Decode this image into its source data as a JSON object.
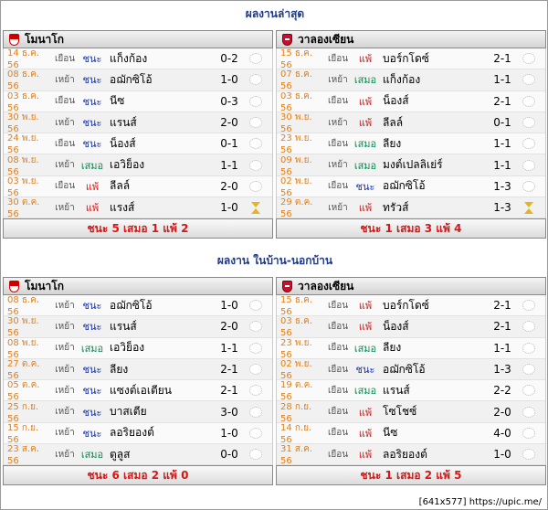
{
  "sections": [
    {
      "title": "ผลงานล่าสุด",
      "panels": [
        {
          "team": "โมนาโก",
          "rows": [
            {
              "date": "14 ธ.ค. 56",
              "venue": "เยือน",
              "result": "ชนะ",
              "opponent": "แก็งก้อง",
              "score": "0-2",
              "icon": "ball-icon"
            },
            {
              "date": "08 ธ.ค. 56",
              "venue": "เหย้า",
              "result": "ชนะ",
              "opponent": "อฌักซิโอ้",
              "score": "1-0",
              "icon": "ball-icon"
            },
            {
              "date": "03 ธ.ค. 56",
              "venue": "เยือน",
              "result": "ชนะ",
              "opponent": "นีซ",
              "score": "0-3",
              "icon": "ball-icon"
            },
            {
              "date": "30 พ.ย. 56",
              "venue": "เหย้า",
              "result": "ชนะ",
              "opponent": "แรนส์",
              "score": "2-0",
              "icon": "ball-icon"
            },
            {
              "date": "24 พ.ย. 56",
              "venue": "เยือน",
              "result": "ชนะ",
              "opponent": "น็องส์",
              "score": "0-1",
              "icon": "ball-icon"
            },
            {
              "date": "08 พ.ย. 56",
              "venue": "เหย้า",
              "result": "เสมอ",
              "opponent": "เอวิย็อง",
              "score": "1-1",
              "icon": "ball-icon"
            },
            {
              "date": "03 พ.ย. 56",
              "venue": "เยือน",
              "result": "แพ้",
              "opponent": "ลีลล์",
              "score": "2-0",
              "icon": "ball-icon"
            },
            {
              "date": "30 ต.ค. 56",
              "venue": "เหย้า",
              "result": "แพ้",
              "opponent": "แรงส์",
              "score": "1-0",
              "icon": "hourglass-icon"
            }
          ],
          "summary": "ชนะ 5 เสมอ 1 แพ้ 2"
        },
        {
          "team": "วาลองเซียน",
          "rows": [
            {
              "date": "15 ธ.ค. 56",
              "venue": "เยือน",
              "result": "แพ้",
              "opponent": "บอร์กโดซ์",
              "score": "2-1",
              "icon": "ball-icon"
            },
            {
              "date": "07 ธ.ค. 56",
              "venue": "เหย้า",
              "result": "เสมอ",
              "opponent": "แก็งก้อง",
              "score": "1-1",
              "icon": "ball-icon"
            },
            {
              "date": "03 ธ.ค. 56",
              "venue": "เยือน",
              "result": "แพ้",
              "opponent": "น็องส์",
              "score": "2-1",
              "icon": "ball-icon"
            },
            {
              "date": "30 พ.ย. 56",
              "venue": "เหย้า",
              "result": "แพ้",
              "opponent": "ลีลล์",
              "score": "0-1",
              "icon": "ball-icon"
            },
            {
              "date": "23 พ.ย. 56",
              "venue": "เยือน",
              "result": "เสมอ",
              "opponent": "ลียง",
              "score": "1-1",
              "icon": "ball-icon"
            },
            {
              "date": "09 พ.ย. 56",
              "venue": "เหย้า",
              "result": "เสมอ",
              "opponent": "มงต์เปลลิเย่ร์",
              "score": "1-1",
              "icon": "ball-icon"
            },
            {
              "date": "02 พ.ย. 56",
              "venue": "เยือน",
              "result": "ชนะ",
              "opponent": "อฌักซิโอ้",
              "score": "1-3",
              "icon": "ball-icon"
            },
            {
              "date": "29 ต.ค. 56",
              "venue": "เหย้า",
              "result": "แพ้",
              "opponent": "ทรัวส์",
              "score": "1-3",
              "icon": "hourglass-icon"
            }
          ],
          "summary": "ชนะ 1 เสมอ 3 แพ้ 4"
        }
      ]
    },
    {
      "title": "ผลงาน ในบ้าน-นอกบ้าน",
      "panels": [
        {
          "team": "โมนาโก",
          "rows": [
            {
              "date": "08 ธ.ค. 56",
              "venue": "เหย้า",
              "result": "ชนะ",
              "opponent": "อฌักซิโอ้",
              "score": "1-0",
              "icon": "ball-icon"
            },
            {
              "date": "30 พ.ย. 56",
              "venue": "เหย้า",
              "result": "ชนะ",
              "opponent": "แรนส์",
              "score": "2-0",
              "icon": "ball-icon"
            },
            {
              "date": "08 พ.ย. 56",
              "venue": "เหย้า",
              "result": "เสมอ",
              "opponent": "เอวิย็อง",
              "score": "1-1",
              "icon": "ball-icon"
            },
            {
              "date": "27 ต.ค. 56",
              "venue": "เหย้า",
              "result": "ชนะ",
              "opponent": "ลียง",
              "score": "2-1",
              "icon": "ball-icon"
            },
            {
              "date": "05 ต.ค. 56",
              "venue": "เหย้า",
              "result": "ชนะ",
              "opponent": "แซงต์เอเตียน",
              "score": "2-1",
              "icon": "ball-icon"
            },
            {
              "date": "25 ก.ย. 56",
              "venue": "เหย้า",
              "result": "ชนะ",
              "opponent": "บาสเตีย",
              "score": "3-0",
              "icon": "ball-icon"
            },
            {
              "date": "15 ก.ย. 56",
              "venue": "เหย้า",
              "result": "ชนะ",
              "opponent": "ลอริยองต์",
              "score": "1-0",
              "icon": "ball-icon"
            },
            {
              "date": "23 ส.ค. 56",
              "venue": "เหย้า",
              "result": "เสมอ",
              "opponent": "ตูลูส",
              "score": "0-0",
              "icon": "ball-icon"
            }
          ],
          "summary": "ชนะ 6 เสมอ 2 แพ้ 0"
        },
        {
          "team": "วาลองเซียน",
          "rows": [
            {
              "date": "15 ธ.ค. 56",
              "venue": "เยือน",
              "result": "แพ้",
              "opponent": "บอร์กโดซ์",
              "score": "2-1",
              "icon": "ball-icon"
            },
            {
              "date": "03 ธ.ค. 56",
              "venue": "เยือน",
              "result": "แพ้",
              "opponent": "น็องส์",
              "score": "2-1",
              "icon": "ball-icon"
            },
            {
              "date": "23 พ.ย. 56",
              "venue": "เยือน",
              "result": "เสมอ",
              "opponent": "ลียง",
              "score": "1-1",
              "icon": "ball-icon"
            },
            {
              "date": "02 พ.ย. 56",
              "venue": "เยือน",
              "result": "ชนะ",
              "opponent": "อฌักซิโอ้",
              "score": "1-3",
              "icon": "ball-icon"
            },
            {
              "date": "19 ต.ค. 56",
              "venue": "เยือน",
              "result": "เสมอ",
              "opponent": "แรนส์",
              "score": "2-2",
              "icon": "ball-icon"
            },
            {
              "date": "28 ก.ย. 56",
              "venue": "เยือน",
              "result": "แพ้",
              "opponent": "โซโชซ์",
              "score": "2-0",
              "icon": "ball-icon"
            },
            {
              "date": "14 ก.ย. 56",
              "venue": "เยือน",
              "result": "แพ้",
              "opponent": "นีซ",
              "score": "4-0",
              "icon": "ball-icon"
            },
            {
              "date": "31 ส.ค. 56",
              "venue": "เยือน",
              "result": "แพ้",
              "opponent": "ลอริยองต์",
              "score": "1-0",
              "icon": "ball-icon"
            }
          ],
          "summary": "ชนะ 1 เสมอ 2 แพ้ 5"
        }
      ]
    }
  ],
  "watermark": "[641x577] https://upic.me/",
  "colors": {
    "win": "#1733a8",
    "draw": "#0a8a50",
    "loss": "#d21818",
    "date": "#e0801a",
    "title": "#1f3a8a"
  }
}
